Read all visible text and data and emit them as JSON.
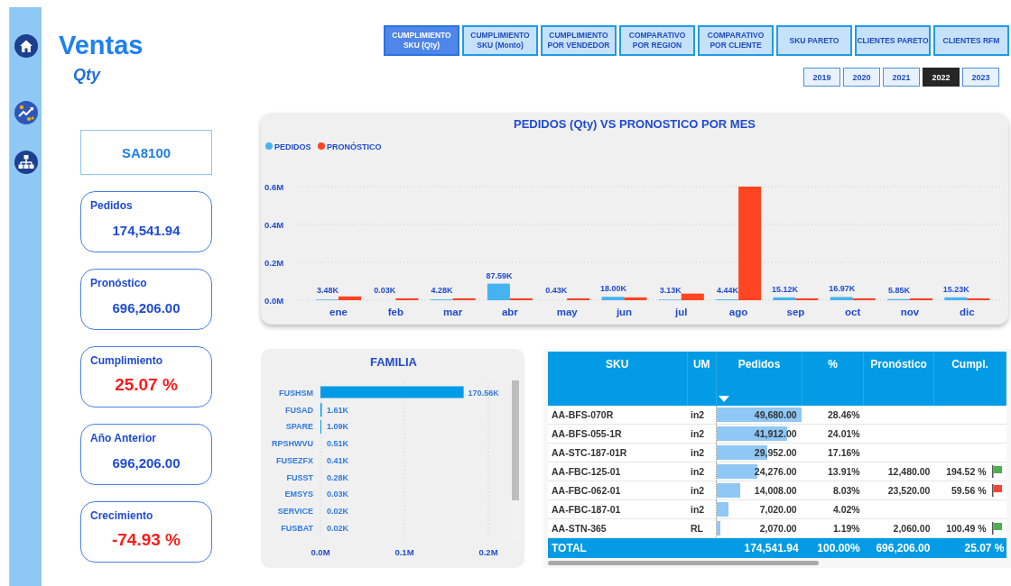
{
  "header": {
    "title": "Ventas",
    "subtitle": "Qty"
  },
  "nav_tabs": [
    {
      "label": "CUMPLIMIENTO SKU (Qty)",
      "selected": true
    },
    {
      "label": "CUMPLIMIENTO SKU (Monto)",
      "selected": false
    },
    {
      "label": "CUMPLIMIENTO POR VENDEDOR",
      "selected": false
    },
    {
      "label": "COMPARATIVO POR REGION",
      "selected": false
    },
    {
      "label": "COMPARATIVO POR CLIENTE",
      "selected": false
    },
    {
      "label": "SKU PARETO",
      "selected": false
    },
    {
      "label": "CLIENTES PARETO",
      "selected": false
    },
    {
      "label": "CLIENTES RFM",
      "selected": false
    }
  ],
  "year_buttons": [
    {
      "label": "2019",
      "selected": false
    },
    {
      "label": "2020",
      "selected": false
    },
    {
      "label": "2021",
      "selected": false
    },
    {
      "label": "2022",
      "selected": true
    },
    {
      "label": "2023",
      "selected": false
    }
  ],
  "filter_box": {
    "value": "SA8100"
  },
  "kpi_cards": [
    {
      "label": "Pedidos",
      "value": "174,541.94",
      "alert": false
    },
    {
      "label": "Pronóstico",
      "value": "696,206.00",
      "alert": false
    },
    {
      "label": "Cumplimiento",
      "value": "25.07 %",
      "alert": true
    },
    {
      "label": "Año Anterior",
      "value": "696,206.00",
      "alert": false
    },
    {
      "label": "Crecimiento",
      "value": "-74.93 %",
      "alert": true
    }
  ],
  "monthly_chart": {
    "chart_data": {
      "type": "bar",
      "title": "PEDIDOS (Qty) VS PRONOSTICO POR MES",
      "categories": [
        "ene",
        "feb",
        "mar",
        "abr",
        "may",
        "jun",
        "jul",
        "ago",
        "sep",
        "oct",
        "nov",
        "dic"
      ],
      "series": [
        {
          "name": "PEDIDOS",
          "color": "#45b3f0",
          "values": [
            3480,
            30,
            4280,
            87590,
            430,
            18000,
            3130,
            4440,
            15120,
            16970,
            5850,
            15230
          ]
        },
        {
          "name": "PRONÓSTICO",
          "color": "#ff4422",
          "values": [
            20000,
            10000,
            10000,
            10000,
            10000,
            15000,
            35000,
            600000,
            10000,
            10000,
            10000,
            10000
          ]
        }
      ],
      "ylim": [
        0,
        600000
      ],
      "grid": true,
      "legend": "top-left",
      "yticks": [
        {
          "value": 0,
          "label": "0.0M"
        },
        {
          "value": 200000,
          "label": "0.2M"
        },
        {
          "value": 400000,
          "label": "0.4M"
        },
        {
          "value": 600000,
          "label": "0.6M"
        }
      ],
      "value_labels": [
        "3.48K",
        "0.03K",
        "4.28K",
        "87.59K",
        "0.43K",
        "18.00K",
        "3.13K",
        "4.44K",
        "15.12K",
        "16.97K",
        "5.85K",
        "15.23K"
      ]
    }
  },
  "familia_chart": {
    "chart_data": {
      "type": "bar",
      "orientation": "horizontal",
      "title": "FAMILIA",
      "categories": [
        "FUSHSM",
        "FUSAD",
        "SPARE",
        "RPSHWVU",
        "FUSEZFX",
        "FUSST",
        "EMSYS",
        "SERVICE",
        "FUSBAT"
      ],
      "values": [
        170560,
        1610,
        1090,
        510,
        410,
        280,
        30,
        20,
        20
      ],
      "xlim": [
        0,
        200000
      ],
      "grid": true,
      "xticks": [
        {
          "value": 0,
          "label": "0.0M"
        },
        {
          "value": 100000,
          "label": "0.1M"
        },
        {
          "value": 200000,
          "label": "0.2M"
        }
      ],
      "value_labels": [
        "170.56K",
        "1.61K",
        "1.09K",
        "0.51K",
        "0.41K",
        "0.28K",
        "0.03K",
        "0.02K",
        "0.02K"
      ]
    }
  },
  "sku_table": {
    "columns": [
      "SKU",
      "UM",
      "Pedidos",
      "%",
      "Pronóstico",
      "Cumpl."
    ],
    "rows": [
      {
        "sku": "AA-BFS-070R",
        "um": "in2",
        "pedidos": "49,680.00",
        "level": 0.99,
        "pct": "28.46%"
      },
      {
        "sku": "AA-BFS-055-1R",
        "um": "in2",
        "pedidos": "41,912.00",
        "level": 0.83,
        "pct": "24.01%"
      },
      {
        "sku": "AA-STC-187-01R",
        "um": "in2",
        "pedidos": "29,952.00",
        "level": 0.59,
        "pct": "17.16%"
      },
      {
        "sku": "AA-FBC-125-01",
        "um": "in2",
        "pedidos": "24,276.00",
        "level": 0.48,
        "pct": "13.91%",
        "pronostico": "12,480.00",
        "cumpl": "194.52 %",
        "color": "#4caf50"
      },
      {
        "sku": "AA-FBC-062-01",
        "um": "in2",
        "pedidos": "14,008.00",
        "level": 0.28,
        "pct": "8.03%",
        "pronostico": "23,520.00",
        "cumpl": "59.56 %",
        "color": "#f44336"
      },
      {
        "sku": "AA-FBC-187-01",
        "um": "in2",
        "pedidos": "7,020.00",
        "level": 0.14,
        "pct": "4.02%"
      },
      {
        "sku": "AA-STN-365",
        "um": "RL",
        "pedidos": "2,070.00",
        "level": 0.04,
        "pct": "1.19%",
        "pronostico": "2,060.00",
        "cumpl": "100.49 %",
        "color": "#4caf50"
      }
    ],
    "total": {
      "label": "TOTAL",
      "pedidos": "174,541.94",
      "pct": "100.00%",
      "pronostico": "696,206.00",
      "cumpl": "25.07 %"
    }
  }
}
